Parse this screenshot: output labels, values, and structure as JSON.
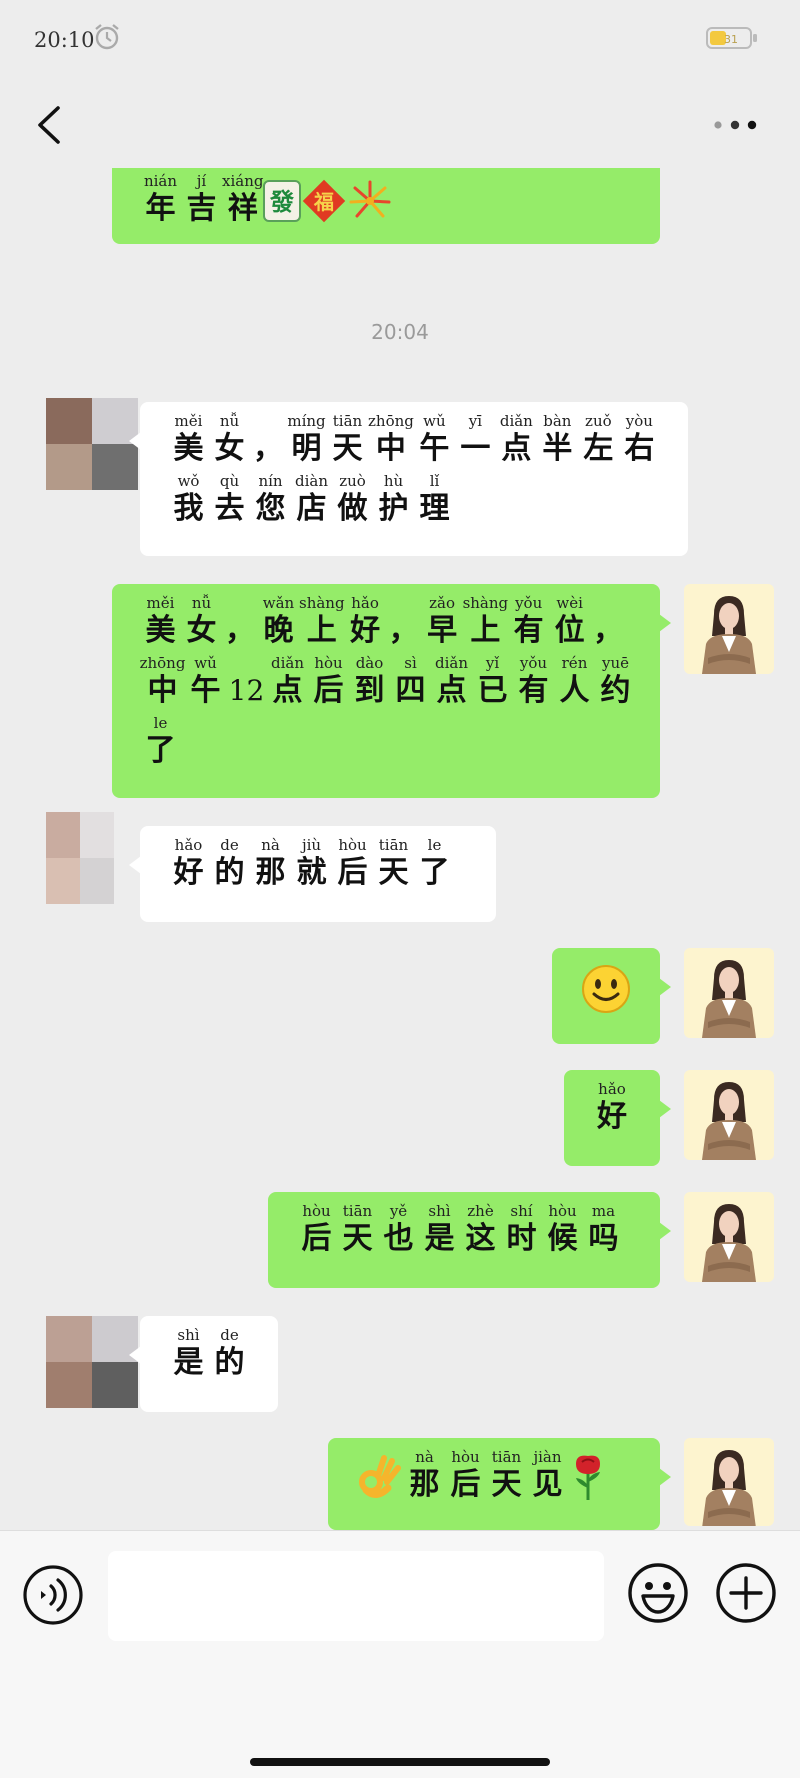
{
  "status_bar": {
    "time": "20:10",
    "battery_level": "31"
  },
  "nav": {
    "back_icon": "chevron-left-icon",
    "more_icon": "more-dots-icon"
  },
  "chat": {
    "time_divider": "20:04",
    "messages": [
      {
        "id": "m0",
        "sender": "me",
        "partial": true,
        "lines": [
          [
            {
              "py": "nián",
              "hz": "年"
            },
            {
              "py": "jí",
              "hz": "吉"
            },
            {
              "py": "xiáng",
              "hz": "祥"
            },
            {
              "emoji": "mahjong-fa-tile"
            },
            {
              "emoji": "red-fu-diamond"
            },
            {
              "emoji": "firework"
            }
          ]
        ]
      },
      {
        "id": "m1",
        "sender": "them",
        "lines": [
          [
            {
              "py": "měi",
              "hz": "美"
            },
            {
              "py": "nǚ",
              "hz": "女"
            },
            {
              "py": "",
              "hz": "，"
            },
            {
              "py": "míng",
              "hz": "明"
            },
            {
              "py": "tiān",
              "hz": "天"
            },
            {
              "py": "zhōng",
              "hz": "中"
            },
            {
              "py": "wǔ",
              "hz": "午"
            },
            {
              "py": "yī",
              "hz": "一"
            },
            {
              "py": "diǎn",
              "hz": "点"
            },
            {
              "py": "bàn",
              "hz": "半"
            },
            {
              "py": "zuǒ",
              "hz": "左"
            },
            {
              "py": "yòu",
              "hz": "右"
            }
          ],
          [
            {
              "py": "wǒ",
              "hz": "我"
            },
            {
              "py": "qù",
              "hz": "去"
            },
            {
              "py": "nín",
              "hz": "您"
            },
            {
              "py": "diàn",
              "hz": "店"
            },
            {
              "py": "zuò",
              "hz": "做"
            },
            {
              "py": "hù",
              "hz": "护"
            },
            {
              "py": "lǐ",
              "hz": "理"
            }
          ]
        ]
      },
      {
        "id": "m2",
        "sender": "me",
        "lines": [
          [
            {
              "py": "měi",
              "hz": "美"
            },
            {
              "py": "nǚ",
              "hz": "女"
            },
            {
              "py": "",
              "hz": "，"
            },
            {
              "py": "wǎn",
              "hz": "晚"
            },
            {
              "py": "shàng",
              "hz": "上"
            },
            {
              "py": "hǎo",
              "hz": "好"
            },
            {
              "py": "",
              "hz": "，"
            },
            {
              "py": "zǎo",
              "hz": "早"
            },
            {
              "py": "shàng",
              "hz": "上"
            },
            {
              "py": "yǒu",
              "hz": "有"
            },
            {
              "py": "wèi",
              "hz": "位"
            },
            {
              "py": "",
              "hz": "，"
            }
          ],
          [
            {
              "py": "zhōng",
              "hz": "中"
            },
            {
              "py": "wǔ",
              "hz": "午"
            },
            {
              "py": "",
              "hz": "12"
            },
            {
              "py": "diǎn",
              "hz": "点"
            },
            {
              "py": "hòu",
              "hz": "后"
            },
            {
              "py": "dào",
              "hz": "到"
            },
            {
              "py": "sì",
              "hz": "四"
            },
            {
              "py": "diǎn",
              "hz": "点"
            },
            {
              "py": "yǐ",
              "hz": "已"
            },
            {
              "py": "yǒu",
              "hz": "有"
            },
            {
              "py": "rén",
              "hz": "人"
            },
            {
              "py": "yuē",
              "hz": "约"
            }
          ],
          [
            {
              "py": "le",
              "hz": "了"
            }
          ]
        ]
      },
      {
        "id": "m3",
        "sender": "them",
        "lines": [
          [
            {
              "py": "hǎo",
              "hz": "好"
            },
            {
              "py": "de",
              "hz": "的"
            },
            {
              "py": "nà",
              "hz": "那"
            },
            {
              "py": "jiù",
              "hz": "就"
            },
            {
              "py": "hòu",
              "hz": "后"
            },
            {
              "py": "tiān",
              "hz": "天"
            },
            {
              "py": "le",
              "hz": "了"
            }
          ]
        ]
      },
      {
        "id": "m4",
        "sender": "me",
        "lines": [
          [
            {
              "emoji": "smile-face"
            }
          ]
        ]
      },
      {
        "id": "m5",
        "sender": "me",
        "lines": [
          [
            {
              "py": "hǎo",
              "hz": "好"
            }
          ]
        ]
      },
      {
        "id": "m6",
        "sender": "me",
        "lines": [
          [
            {
              "py": "hòu",
              "hz": "后"
            },
            {
              "py": "tiān",
              "hz": "天"
            },
            {
              "py": "yě",
              "hz": "也"
            },
            {
              "py": "shì",
              "hz": "是"
            },
            {
              "py": "zhè",
              "hz": "这"
            },
            {
              "py": "shí",
              "hz": "时"
            },
            {
              "py": "hòu",
              "hz": "候"
            },
            {
              "py": "ma",
              "hz": "吗"
            }
          ]
        ]
      },
      {
        "id": "m7",
        "sender": "them",
        "lines": [
          [
            {
              "py": "shì",
              "hz": "是"
            },
            {
              "py": "de",
              "hz": "的"
            }
          ]
        ]
      },
      {
        "id": "m8",
        "sender": "me",
        "lines": [
          [
            {
              "emoji": "ok-hand"
            },
            {
              "py": "nà",
              "hz": "那"
            },
            {
              "py": "hòu",
              "hz": "后"
            },
            {
              "py": "tiān",
              "hz": "天"
            },
            {
              "py": "jiàn",
              "hz": "见"
            },
            {
              "emoji": "rose"
            }
          ]
        ]
      }
    ]
  },
  "input_bar": {
    "input_value": "",
    "voice_icon": "voice-icon",
    "emoji_icon": "emoji-face-icon",
    "plus_icon": "plus-icon"
  },
  "colors": {
    "background": "#ededed",
    "my_bubble": "#95ec69",
    "their_bubble": "#ffffff",
    "my_avatar_bg": "#fdf4cf"
  }
}
